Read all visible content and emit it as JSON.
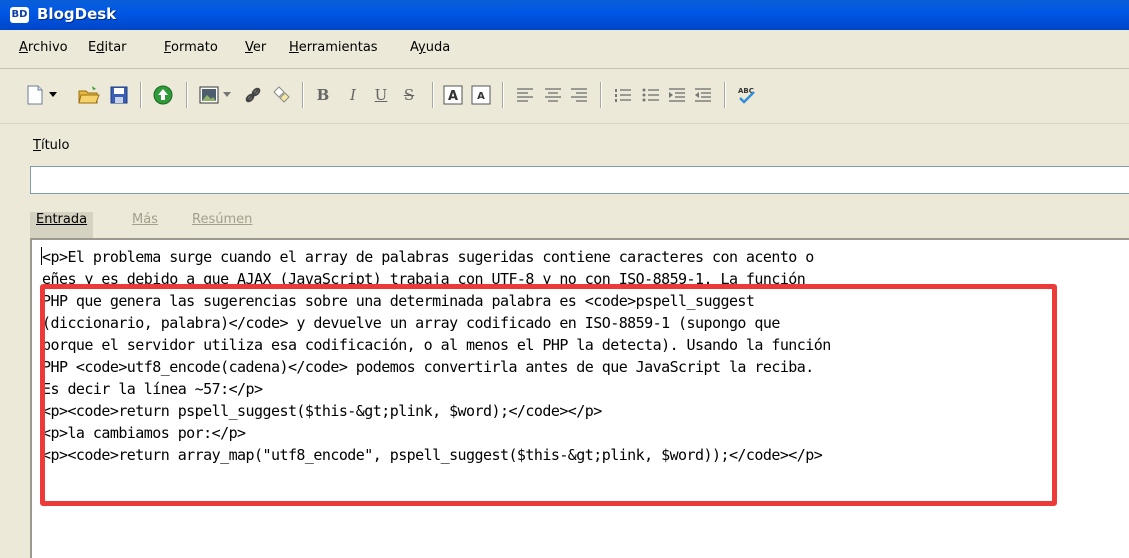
{
  "window": {
    "badge": "BD",
    "title": "BlogDesk"
  },
  "menu": [
    {
      "pre": "",
      "key": "A",
      "post": "rchivo"
    },
    {
      "pre": "E",
      "key": "d",
      "post": "itar"
    },
    {
      "pre": "",
      "key": "F",
      "post": "ormato"
    },
    {
      "pre": "",
      "key": "V",
      "post": "er"
    },
    {
      "pre": "",
      "key": "H",
      "post": "erramientas"
    },
    {
      "pre": "A",
      "key": "y",
      "post": "uda"
    }
  ],
  "toolbar": {
    "icons": [
      "new-document-icon",
      "dropdown-arrow-icon",
      "open-folder-icon",
      "save-icon",
      "publish-icon",
      "insert-image-icon",
      "dropdown-arrow-icon",
      "insert-link-icon",
      "unlink-icon",
      "bold-icon",
      "italic-icon",
      "underline-icon",
      "strikethrough-icon",
      "font-larger-icon",
      "font-smaller-icon",
      "align-left-icon",
      "align-center-icon",
      "align-right-icon",
      "ordered-list-icon",
      "unordered-list-icon",
      "indent-icon",
      "outdent-icon",
      "spellcheck-icon"
    ],
    "bold_label": "B",
    "italic_label": "I",
    "underline_label": "U",
    "strike_label": "S",
    "spell_label": "ABC"
  },
  "title_field": {
    "label_key": "T",
    "label_rest": "ítulo",
    "value": ""
  },
  "tabs": [
    {
      "label": "Entrada",
      "active": true
    },
    {
      "label": "Más",
      "active": false
    },
    {
      "label": "Resúmen",
      "active": false
    }
  ],
  "editor": {
    "lines": [
      "<p>El problema surge cuando el array de palabras sugeridas contiene caracteres con acento o",
      "eñes y es debido a que AJAX (JavaScript) trabaja con UTF-8 y no con ISO-8859-1. La función",
      "PHP que genera las sugerencias sobre una determinada palabra es <code>pspell_suggest",
      "(diccionario, palabra)</code> y devuelve un array codificado en ISO-8859-1 (supongo que",
      "porque el servidor utiliza esa codificación, o al menos el PHP la detecta). Usando la función",
      "PHP <code>utf8_encode(cadena)</code> podemos convertirla antes de que JavaScript la reciba.",
      "Es decir la línea ~57:</p>",
      "<p><code>return pspell_suggest($this-&gt;plink, $word);</code></p>",
      "<p>la cambiamos por:</p>",
      "<p><code>return array_map(\"utf8_encode\", pspell_suggest($this-&gt;plink, $word));</code></p>"
    ]
  },
  "colors": {
    "titlebar": "#0058e6",
    "highlight": "#ee3939",
    "chrome": "#ece9d8"
  }
}
